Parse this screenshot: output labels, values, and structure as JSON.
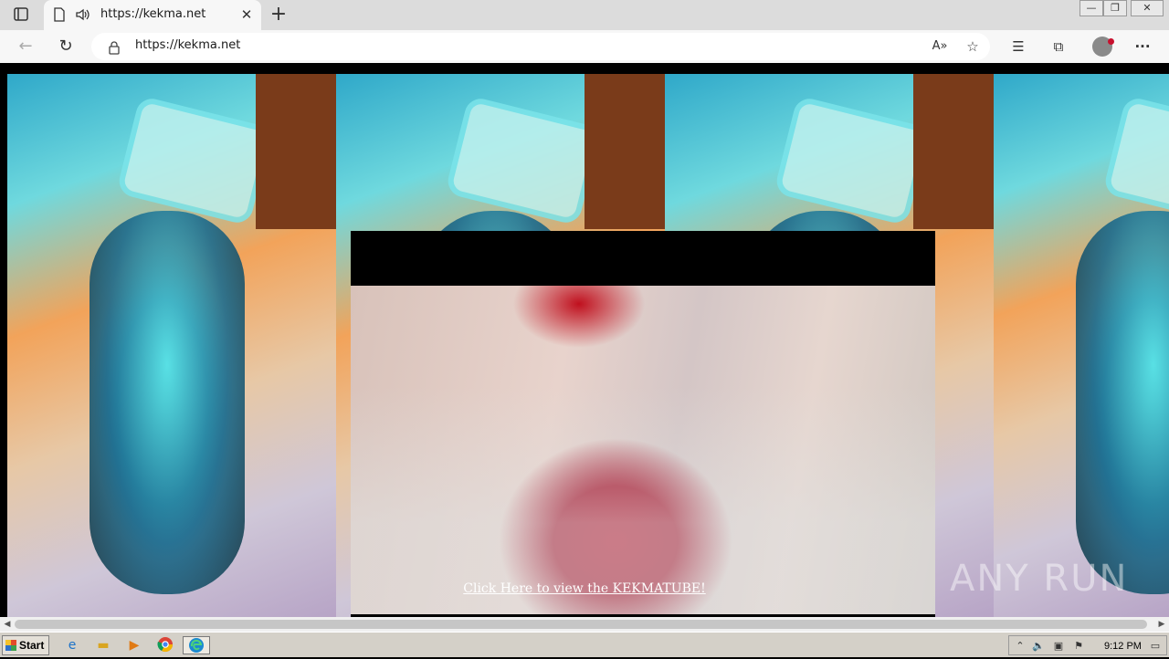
{
  "browser": {
    "tab": {
      "title": "https://kekma.net",
      "close_glyph": "✕",
      "icons": [
        "page-icon",
        "audio-playing-icon"
      ]
    },
    "new_tab_glyph": "+",
    "window_controls": [
      "—",
      "❐",
      "✕"
    ],
    "address": {
      "url": "https://kekma.net",
      "lock_icon": "lock-icon"
    },
    "nav": {
      "back_glyph": "←",
      "reload_glyph": "↻"
    },
    "toolbar": {
      "read_aloud_glyph": "A»",
      "add_favorite_glyph": "☆",
      "favorites_glyph": "☰",
      "collections_glyph": "⧉",
      "more_glyph": "···"
    }
  },
  "page": {
    "cta_link": "Click Here to view the KEKMATUBE!",
    "background_color": "#000000",
    "link_color": "#ffffff"
  },
  "overlay": {
    "watermark": "ANY RUN"
  },
  "taskbar": {
    "start_label": "Start",
    "pinned": [
      "internet-explorer-icon",
      "file-explorer-icon",
      "media-player-icon",
      "chrome-icon",
      "edge-icon"
    ],
    "clock": "9:12 PM"
  }
}
